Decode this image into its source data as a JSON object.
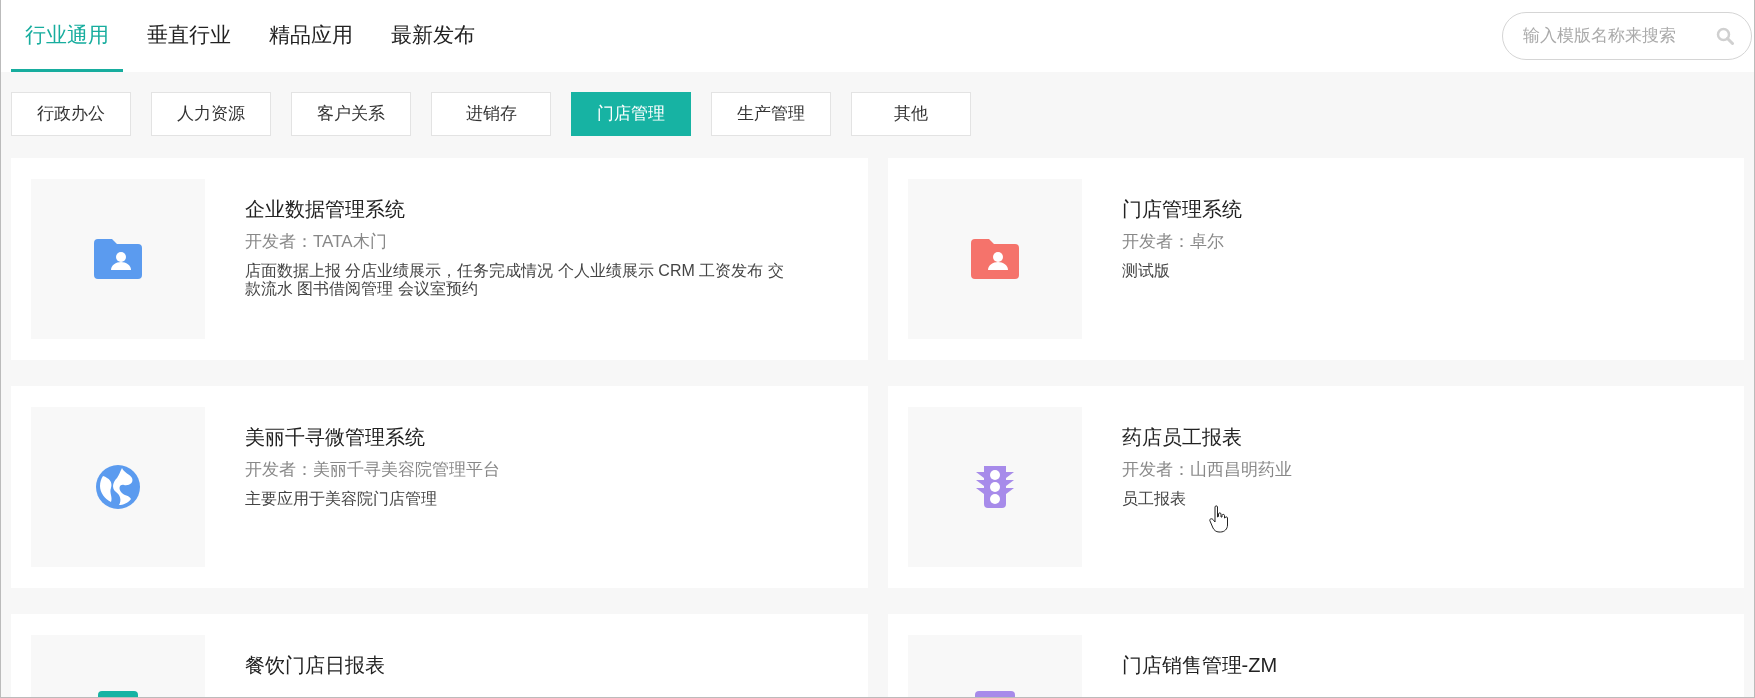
{
  "tabs": [
    {
      "label": "行业通用",
      "selected": true
    },
    {
      "label": "垂直行业",
      "selected": false
    },
    {
      "label": "精品应用",
      "selected": false
    },
    {
      "label": "最新发布",
      "selected": false
    }
  ],
  "search": {
    "placeholder": "输入模版名称来搜索"
  },
  "categories": [
    {
      "label": "行政办公",
      "selected": false
    },
    {
      "label": "人力资源",
      "selected": false
    },
    {
      "label": "客户关系",
      "selected": false
    },
    {
      "label": "进销存",
      "selected": false
    },
    {
      "label": "门店管理",
      "selected": true
    },
    {
      "label": "生产管理",
      "selected": false
    },
    {
      "label": "其他",
      "selected": false
    }
  ],
  "apps": [
    {
      "title": "企业数据管理系统",
      "developer": "开发者：TATA木门",
      "description": "店面数据上报 分店业绩展示，任务完成情况 个人业绩展示 CRM 工资发布 交款流水 图书借阅管理 会议室预约",
      "icon": {
        "kind": "folder-user",
        "color": "#5b9bef"
      }
    },
    {
      "title": "门店管理系统",
      "developer": "开发者：卓尔",
      "description": "测试版",
      "icon": {
        "kind": "folder-user",
        "color": "#f5736b"
      }
    },
    {
      "title": "美丽千寻微管理系统",
      "developer": "开发者：美丽千寻美容院管理平台",
      "description": "主要应用于美容院门店管理",
      "icon": {
        "kind": "globe",
        "color": "#5b9bef"
      }
    },
    {
      "title": "药店员工报表",
      "developer": "开发者：山西昌明药业",
      "description": "员工报表",
      "icon": {
        "kind": "traffic-light",
        "color": "#a78bea"
      }
    },
    {
      "title": "餐饮门店日报表",
      "icon": {
        "kind": "tile",
        "color": "#17b3a3"
      }
    },
    {
      "title": "门店销售管理-ZM",
      "icon": {
        "kind": "tile",
        "color": "#a78bea"
      }
    }
  ],
  "cursor": {
    "kind": "hand"
  }
}
